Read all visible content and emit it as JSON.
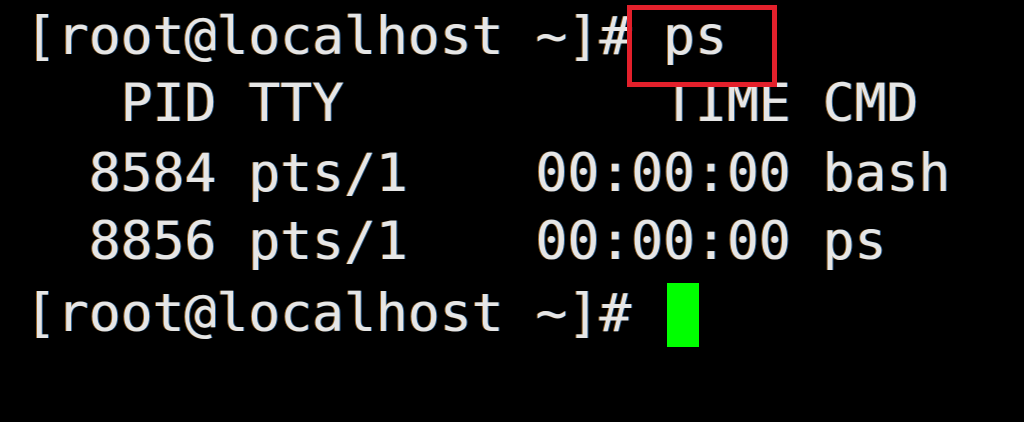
{
  "terminal": {
    "lines": [
      "[root@localhost ~]# ps",
      "   PID TTY          TIME CMD",
      "  8584 pts/1    00:00:00 bash",
      "  8856 pts/1    00:00:00 ps",
      "[root@localhost ~]# "
    ],
    "highlight_color": "#e3202b",
    "cursor_color": "#00ff00"
  }
}
